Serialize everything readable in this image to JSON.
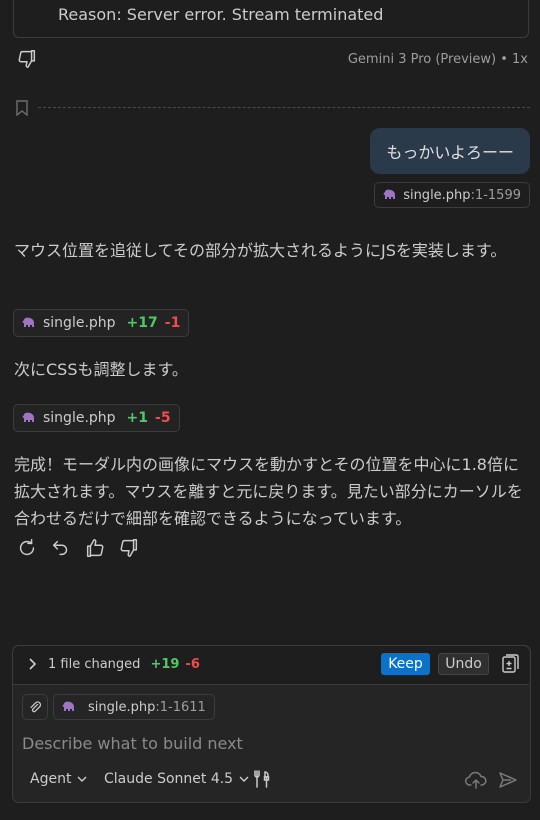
{
  "error": {
    "text": "Reason: Server error. Stream terminated"
  },
  "response_meta": {
    "model": "Gemini 3 Pro (Preview) • 1x"
  },
  "user_message": {
    "text": "もっかいよろーー",
    "context": {
      "file": "single.php",
      "range": ":1-1599"
    }
  },
  "assistant": {
    "paragraph1": "マウス位置を追従してその部分が拡大されるようにJSを実装します。",
    "edit1": {
      "file": "single.php",
      "added": "+17",
      "removed": "-1"
    },
    "paragraph2": "次にCSSも調整します。",
    "edit2": {
      "file": "single.php",
      "added": "+1",
      "removed": "-5"
    },
    "paragraph3": "完成！モーダル内の画像にマウスを動かすとその位置を中心に1.8倍に拡大されます。マウスを離すと元に戻ります。見たい部分にカーソルを合わせるだけで細部を確認できるようになっています。"
  },
  "changes": {
    "summary": "1 file changed",
    "added": "+19",
    "removed": "-6",
    "keep_label": "Keep",
    "undo_label": "Undo"
  },
  "composer": {
    "context": {
      "file": "single.php",
      "range": ":1-1611"
    },
    "placeholder": "Describe what to build next",
    "mode": "Agent",
    "model": "Claude Sonnet 4.5"
  },
  "colors": {
    "background": "#1e1e1e",
    "added": "#4ec966",
    "removed": "#f14c4c",
    "keep_button": "#0a73c9",
    "php_icon": "#a074c4",
    "user_bubble": "#2b3a4a"
  },
  "icons": {
    "file": "php-elephant-icon",
    "dislike": "thumbs-down-icon",
    "like": "thumbs-up-icon",
    "retry": "refresh-icon",
    "undo": "undo-icon",
    "bookmark": "bookmark-icon",
    "attach": "paperclip-icon",
    "tools": "tools-icon",
    "send": "send-icon"
  }
}
